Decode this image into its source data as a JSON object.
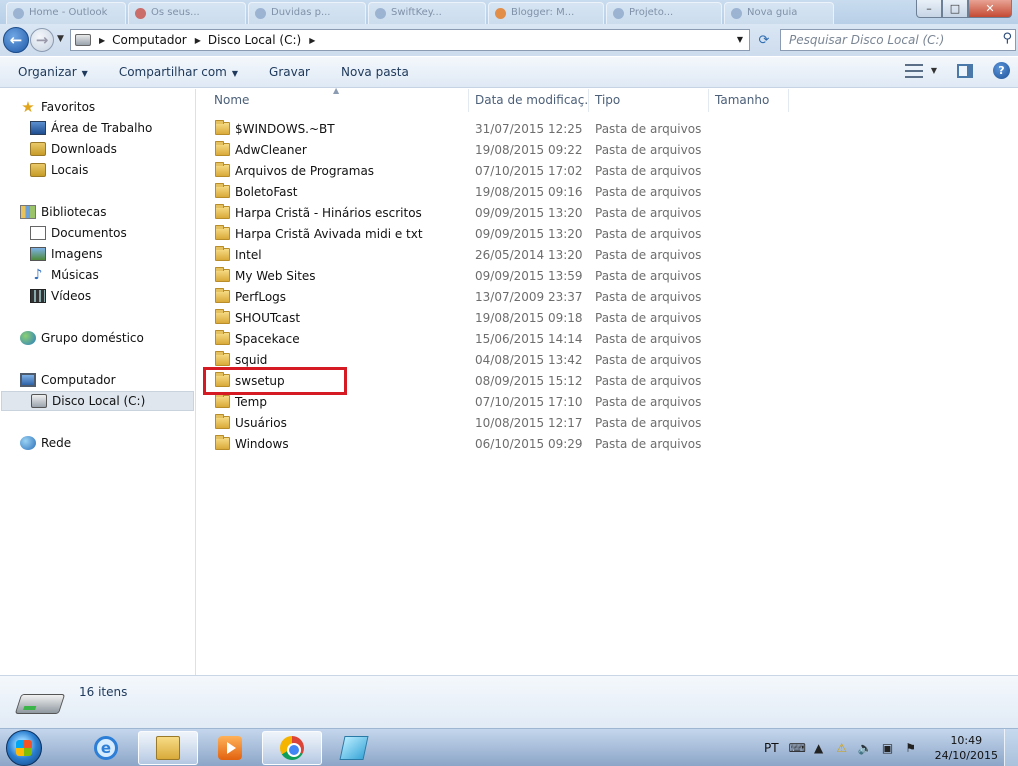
{
  "browser_tabs": [
    {
      "label": "Home - Outlook"
    },
    {
      "label": "Os seus..."
    },
    {
      "label": "Duvidas p..."
    },
    {
      "label": "SwiftKey..."
    },
    {
      "label": "Blogger: M..."
    },
    {
      "label": "Projeto..."
    },
    {
      "label": "Nova guia"
    }
  ],
  "window_buttons": {
    "minimize": "–",
    "maximize": "□",
    "close": "✕"
  },
  "address": {
    "breadcrumbs": [
      "Computador",
      "Disco Local (C:)"
    ],
    "search_placeholder": "Pesquisar Disco Local (C:)"
  },
  "toolbar": {
    "organize": "Organizar",
    "share": "Compartilhar com",
    "burn": "Gravar",
    "new_folder": "Nova pasta",
    "help": "?"
  },
  "nav": {
    "favorites": "Favoritos",
    "desktop": "Área de Trabalho",
    "downloads": "Downloads",
    "places": "Locais",
    "libraries": "Bibliotecas",
    "documents": "Documentos",
    "pictures": "Imagens",
    "music": "Músicas",
    "videos": "Vídeos",
    "homegroup": "Grupo doméstico",
    "computer": "Computador",
    "local_disk": "Disco Local (C:)",
    "network": "Rede"
  },
  "columns": {
    "name": "Nome",
    "date": "Data de modificaç...",
    "type": "Tipo",
    "size": "Tamanho"
  },
  "files": [
    {
      "name": "$WINDOWS.~BT",
      "date": "31/07/2015 12:25",
      "type": "Pasta de arquivos"
    },
    {
      "name": "AdwCleaner",
      "date": "19/08/2015 09:22",
      "type": "Pasta de arquivos"
    },
    {
      "name": "Arquivos de Programas",
      "date": "07/10/2015 17:02",
      "type": "Pasta de arquivos"
    },
    {
      "name": "BoletoFast",
      "date": "19/08/2015 09:16",
      "type": "Pasta de arquivos"
    },
    {
      "name": "Harpa Cristã - Hinários escritos",
      "date": "09/09/2015 13:20",
      "type": "Pasta de arquivos"
    },
    {
      "name": "Harpa Cristã Avivada midi e txt",
      "date": "09/09/2015 13:20",
      "type": "Pasta de arquivos"
    },
    {
      "name": "Intel",
      "date": "26/05/2014 13:20",
      "type": "Pasta de arquivos"
    },
    {
      "name": "My Web Sites",
      "date": "09/09/2015 13:59",
      "type": "Pasta de arquivos"
    },
    {
      "name": "PerfLogs",
      "date": "13/07/2009 23:37",
      "type": "Pasta de arquivos"
    },
    {
      "name": "SHOUTcast",
      "date": "19/08/2015 09:18",
      "type": "Pasta de arquivos"
    },
    {
      "name": "Spacekace",
      "date": "15/06/2015 14:14",
      "type": "Pasta de arquivos"
    },
    {
      "name": "squid",
      "date": "04/08/2015 13:42",
      "type": "Pasta de arquivos"
    },
    {
      "name": "swsetup",
      "date": "08/09/2015 15:12",
      "type": "Pasta de arquivos"
    },
    {
      "name": "Temp",
      "date": "07/10/2015 17:10",
      "type": "Pasta de arquivos"
    },
    {
      "name": "Usuários",
      "date": "10/08/2015 12:17",
      "type": "Pasta de arquivos"
    },
    {
      "name": "Windows",
      "date": "06/10/2015 09:29",
      "type": "Pasta de arquivos"
    }
  ],
  "details": {
    "count": "16 itens"
  },
  "taskbar": {
    "language": "PT",
    "time": "10:49",
    "date": "24/10/2015"
  },
  "colors": {
    "highlight_border": "#d51a24",
    "taskbar": "#8fa9c9"
  }
}
